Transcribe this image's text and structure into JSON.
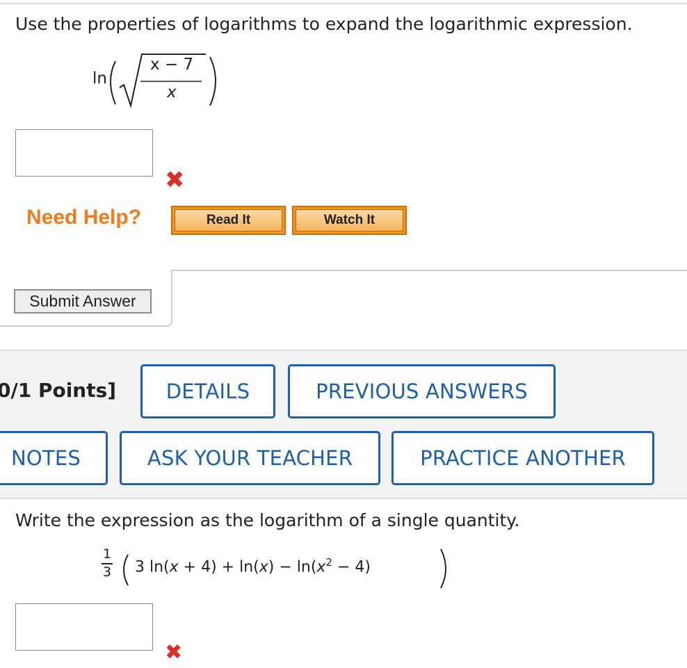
{
  "q1": {
    "prompt": "Use the properties of logarithms to expand the logarithmic expression.",
    "expr": {
      "fn": "ln",
      "numerator": "x − 7",
      "denominator": "x"
    }
  },
  "help": {
    "label": "Need Help?",
    "read_it": "Read It",
    "watch_it": "Watch It"
  },
  "submit_label": "Submit Answer",
  "q2_header": {
    "points": "0/1 Points]",
    "details": "DETAILS",
    "previous_answers": "PREVIOUS ANSWERS",
    "notes": "NOTES",
    "ask_teacher": "ASK YOUR TEACHER",
    "practice_another": "PRACTICE ANOTHER"
  },
  "q2": {
    "prompt": "Write the expression as the logarithm of a single quantity.",
    "frac_num": "1",
    "frac_den": "3",
    "body_part1": "3 ln(",
    "var1": "x",
    "body_part2": " + 4) + ln(",
    "var2": "x",
    "body_part3": ") − ln(",
    "var3": "x",
    "exp": "2",
    "body_part4": " − 4)"
  },
  "colors": {
    "accent_blue": "#1d5fa8",
    "error_red": "#d9302c",
    "help_orange": "#f07c1c"
  },
  "icons": {
    "incorrect": "x-mark-icon"
  }
}
